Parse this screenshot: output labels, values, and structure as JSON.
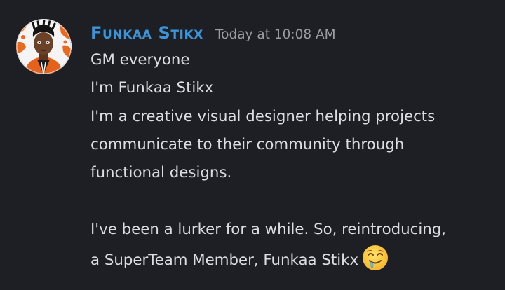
{
  "message": {
    "author": {
      "name": "Funkaa Stikx",
      "avatar_icon": "avatar-cartoon-icon",
      "name_color": "#3b94d9"
    },
    "timestamp": "Today at 10:08 AM",
    "lines": [
      "GM everyone",
      "I'm Funkaa Stikx",
      "I'm a creative visual designer helping projects",
      "communicate to their community through",
      "functional designs.",
      "",
      "I've been a lurker for a while. So, reintroducing,",
      "a SuperTeam Member, Funkaa Stikx"
    ],
    "emoji": "drooling-face-icon"
  },
  "colors": {
    "background": "#1e1f24",
    "text": "#dcdde1",
    "timestamp": "#9a9ca3"
  }
}
